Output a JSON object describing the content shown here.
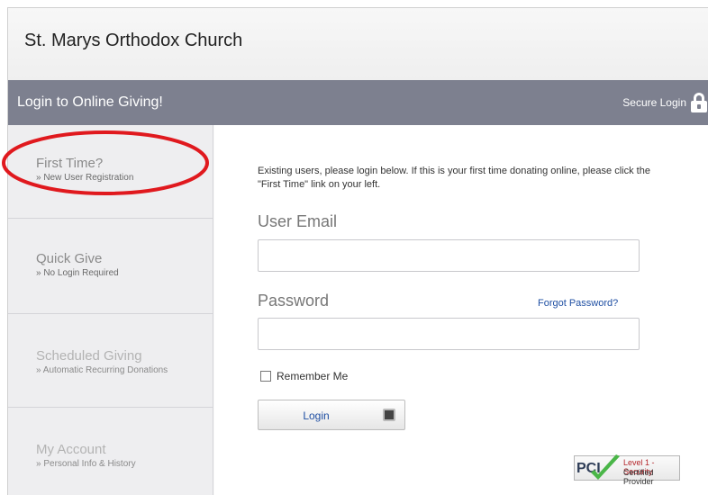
{
  "header": {
    "church_name": "St. Marys Orthodox Church"
  },
  "titlebar": {
    "title": "Login to Online Giving!",
    "secure_label": "Secure Login",
    "icon": "lock-icon"
  },
  "sidebar": {
    "items": [
      {
        "label": "First Time?",
        "sub": "» New User Registration"
      },
      {
        "label": "Quick Give",
        "sub": "» No Login Required"
      },
      {
        "label": "Scheduled Giving",
        "sub": "» Automatic Recurring Donations"
      },
      {
        "label": "My Account",
        "sub": "» Personal Info & History"
      }
    ]
  },
  "annotation": {
    "color": "#e0191e"
  },
  "login": {
    "intro": "Existing users, please login below. If this is your first time donating online, please click the \"First Time\" link on your left.",
    "email_label": "User Email",
    "email_value": "",
    "password_label": "Password",
    "password_value": "",
    "forgot_label": "Forgot Password?",
    "remember_label": "Remember Me",
    "remember_checked": false,
    "button_label": "Login"
  },
  "badge": {
    "logo": "PCI",
    "line1": "Level 1 - Security",
    "line2": "Certified Provider"
  },
  "colors": {
    "titlebar": "#7d808f",
    "link": "#1f4fa3",
    "sidebar_bg": "#eeeef0"
  }
}
